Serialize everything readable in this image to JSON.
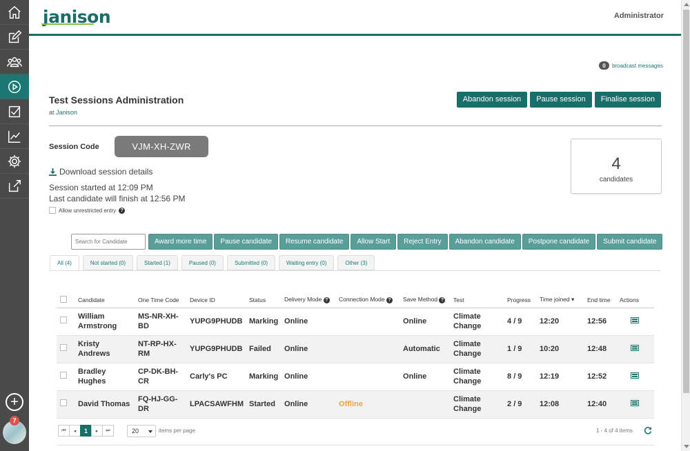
{
  "app": {
    "logo": "janison",
    "user": "Administrator"
  },
  "rail": {
    "items": [
      {
        "icon": "home-icon",
        "active": false
      },
      {
        "icon": "edit-icon",
        "active": false
      },
      {
        "icon": "users-icon",
        "active": false
      },
      {
        "icon": "play-icon",
        "active": true
      },
      {
        "icon": "checklist-icon",
        "active": false
      },
      {
        "icon": "chart-icon",
        "active": false
      },
      {
        "icon": "gear-icon",
        "active": false
      },
      {
        "icon": "external-link-icon",
        "active": false
      }
    ],
    "add_label": "+",
    "notifications": "7"
  },
  "broadcast": {
    "count": "0",
    "label": "broadcast messages"
  },
  "page": {
    "title": "Test Sessions Administration",
    "at_prefix": "at ",
    "org": "Janison"
  },
  "session_actions": {
    "abandon": "Abandon session",
    "pause": "Pause session",
    "finalise": "Finalise session"
  },
  "session": {
    "code_label": "Session Code",
    "code": "VJM-XH-ZWR",
    "download": "Download session details",
    "started": "Session started at 12:09 PM",
    "finish": "Last candidate will finish at 12:56 PM",
    "unrestricted": "Allow unrestricted entry"
  },
  "candidates_box": {
    "count": "4",
    "label": "candidates"
  },
  "search": {
    "placeholder": "Search for Candidate"
  },
  "toolbar": {
    "award": "Award more time",
    "pause": "Pause candidate",
    "resume": "Resume candidate",
    "allow": "Allow Start",
    "reject": "Reject Entry",
    "abandon": "Abandon candidate",
    "postpone": "Postpone candidate",
    "submit": "Submit candidate"
  },
  "tabs": {
    "all": "All (4)",
    "not_started": "Not started (0)",
    "started": "Started (1)",
    "paused": "Paused (0)",
    "submitted": "Submitted (0)",
    "waiting": "Waiting entry (0)",
    "other": "Other (3)"
  },
  "table": {
    "headers": {
      "candidate": "Candidate",
      "otc": "One Time Code",
      "device": "Device ID",
      "status": "Status",
      "delivery": "Delivery Mode",
      "connection": "Connection Mode",
      "save": "Save Method",
      "test": "Test",
      "progress": "Progress",
      "joined": "Time joined ▾",
      "end": "End time",
      "actions": "Actions"
    },
    "rows": [
      {
        "candidate": "William Armstrong",
        "otc": "MS-NR-XH-BD",
        "device": "YUPG9PHUDB",
        "status": "Marking",
        "delivery": "Online",
        "connection": "",
        "save": "Online",
        "test": "Climate Change",
        "progress": "4 / 9",
        "joined": "12:20",
        "end": "12:56"
      },
      {
        "candidate": "Kristy Andrews",
        "otc": "NT-RP-HX-RM",
        "device": "YUPG9PHUDB",
        "status": "Failed",
        "delivery": "Online",
        "connection": "",
        "save": "Automatic",
        "test": "Climate Change",
        "progress": "1 / 9",
        "joined": "10:20",
        "end": "12:48"
      },
      {
        "candidate": "Bradley Hughes",
        "otc": "CP-DK-BH-CR",
        "device": "Carly's PC",
        "status": "Marking",
        "delivery": "Online",
        "connection": "",
        "save": "Online",
        "test": "Climate Change",
        "progress": "8 / 9",
        "joined": "12:19",
        "end": "12:52"
      },
      {
        "candidate": "David Thomas",
        "otc": "FQ-HJ-GG-DR",
        "device": "LPACSAWFHM",
        "status": "Started",
        "delivery": "Online",
        "connection": "Offline",
        "save": "",
        "test": "Climate Change",
        "progress": "2 / 9",
        "joined": "12:08",
        "end": "12:40"
      }
    ]
  },
  "pager": {
    "first": "⏮",
    "prev": "◂",
    "current": "1",
    "next": "▸",
    "last": "⏭",
    "per_page": "20",
    "per_page_label": "items per page",
    "range": "1 - 4 of 4 items"
  },
  "colors": {
    "brand": "#1a6e6a",
    "action": "#5a9e99",
    "offline": "#e8a54a",
    "logo_accent": "#8fc046"
  }
}
